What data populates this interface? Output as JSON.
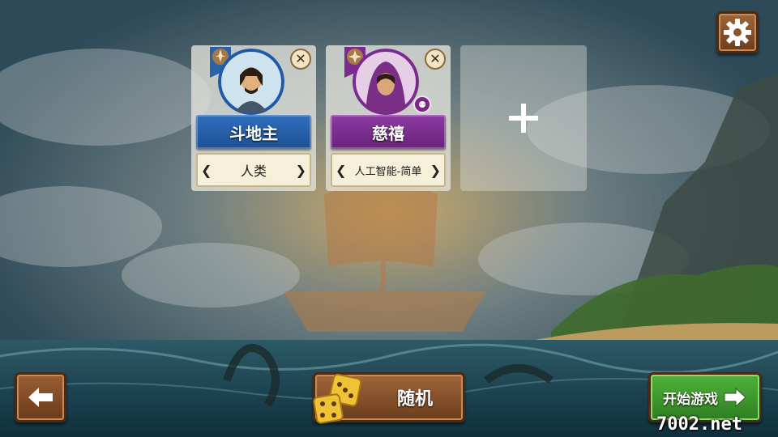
{
  "players": [
    {
      "name": "斗地主",
      "type": "人类",
      "name_color": "#1e5aa8",
      "emblem": "fleur-de-lis-icon",
      "avatar": "knight-avatar"
    },
    {
      "name": "慈禧",
      "type": "人工智能-简单",
      "name_color": "#7b2a8f",
      "emblem": "star-icon",
      "avatar": "hooded-assassin-avatar",
      "badge": "robot-icon"
    }
  ],
  "add_slot": {
    "icon": "plus-icon"
  },
  "toolbar": {
    "settings_icon": "gear-icon",
    "back_icon": "arrow-left-icon",
    "random_label": "随机",
    "random_icon": "dice-icon",
    "start_label": "开始游戏",
    "start_icon": "arrow-right-icon"
  },
  "watermark": "7002.net",
  "colors": {
    "wood": "#8a5330",
    "start_green": "#3f9a2e",
    "blue_plate": "#1e5aa8",
    "purple_plate": "#7b2a8f"
  }
}
